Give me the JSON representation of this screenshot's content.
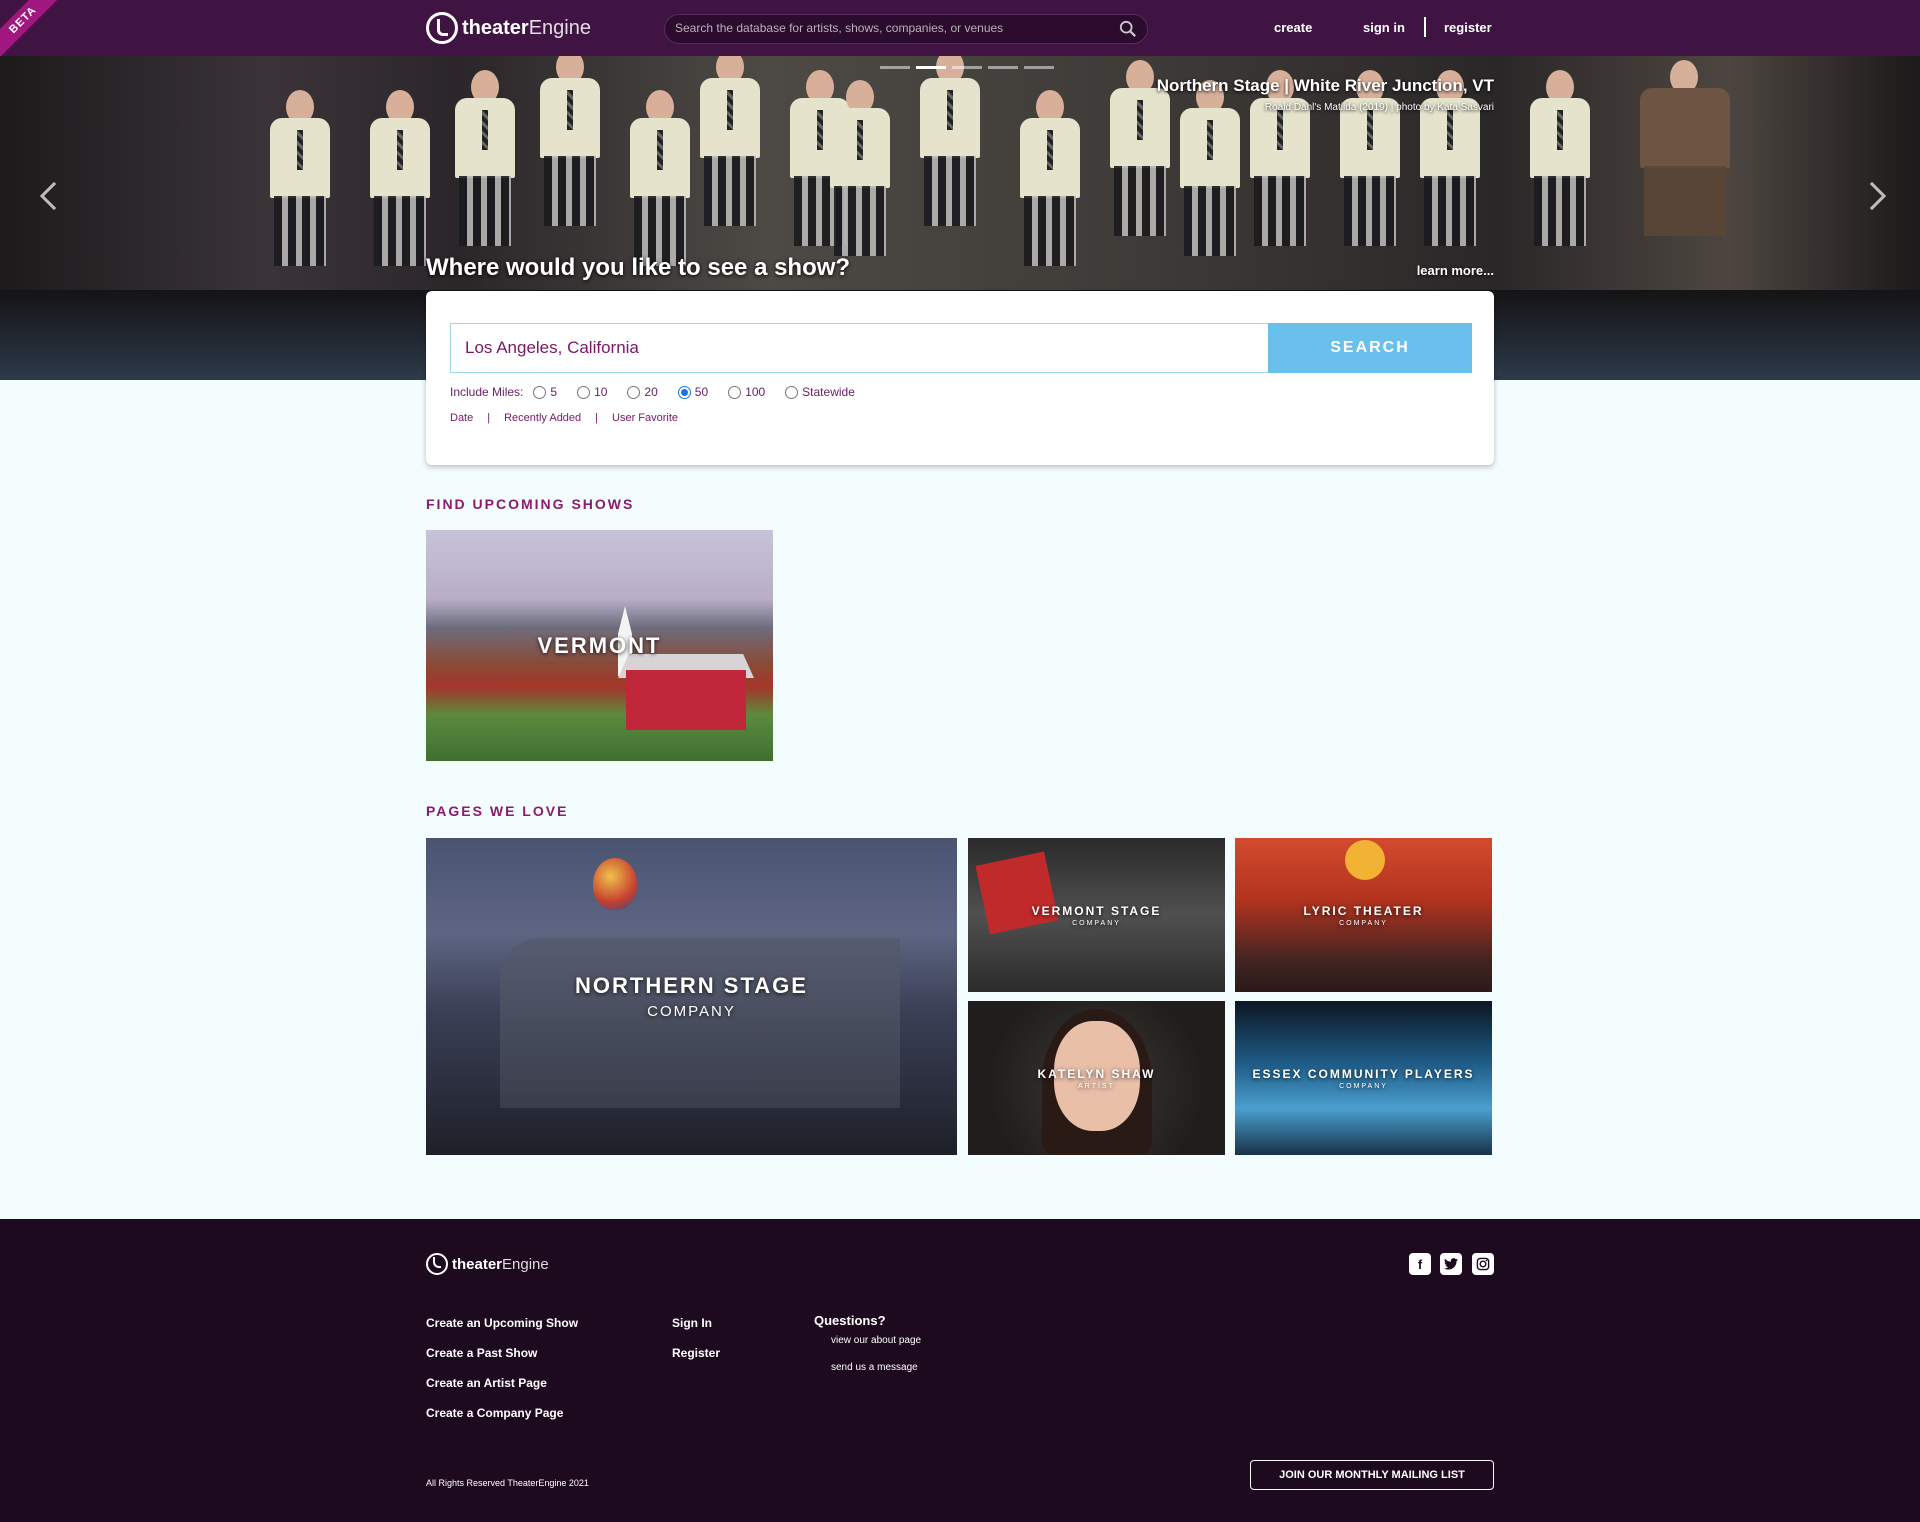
{
  "header": {
    "beta_label": "BETA",
    "logo_bold": "theater",
    "logo_light": "Engine",
    "search_placeholder": "Search the database for artists, shows, companies, or venues",
    "nav_create": "create",
    "nav_signin": "sign in",
    "nav_register": "register"
  },
  "hero": {
    "location": "Northern Stage | White River Junction, VT",
    "credit": "Roald Dahl's Matilda (2019) | photo by Kata Sasvari",
    "question": "Where would you like to see a show?",
    "learn_more": "learn more..."
  },
  "search": {
    "location_value": "Los Angeles, California",
    "button_label": "SEARCH",
    "miles_label": "Include Miles:",
    "miles_options": [
      "5",
      "10",
      "20",
      "50",
      "100",
      "Statewide"
    ],
    "miles_selected": "50",
    "sort_options": [
      "Date",
      "Recently Added",
      "User Favorite"
    ],
    "sort_separator": "|"
  },
  "upcoming": {
    "title": "FIND UPCOMING SHOWS",
    "tiles": [
      {
        "name": "VERMONT"
      }
    ]
  },
  "pages": {
    "title": "PAGES WE LOVE",
    "tiles": [
      {
        "name": "NORTHERN STAGE",
        "type": "COMPANY"
      },
      {
        "name": "VERMONT STAGE",
        "type": "COMPANY"
      },
      {
        "name": "LYRIC THEATER",
        "type": "COMPANY"
      },
      {
        "name": "KATELYN SHAW",
        "type": "ARTIST"
      },
      {
        "name": "ESSEX COMMUNITY PLAYERS",
        "type": "COMPANY"
      }
    ]
  },
  "footer": {
    "logo_bold": "theater",
    "logo_light": "Engine",
    "create_links": [
      "Create an Upcoming Show",
      "Create a Past Show",
      "Create an Artist Page",
      "Create a Company Page"
    ],
    "account_links": [
      "Sign In",
      "Register"
    ],
    "questions_title": "Questions?",
    "question_links": [
      "view our about page",
      "send us a message"
    ],
    "social_icons": [
      "facebook-icon",
      "twitter-icon",
      "instagram-icon"
    ],
    "copyright": "All Rights Reserved TheaterEngine 2021",
    "mailing_button": "JOIN OUR MONTHLY MAILING LIST"
  },
  "colors": {
    "header_bg": "#3f1443",
    "footer_bg": "#1e0a1f",
    "accent": "#8b1a70",
    "search_button": "#69c0ec",
    "page_bg": "#f3fdfd"
  }
}
